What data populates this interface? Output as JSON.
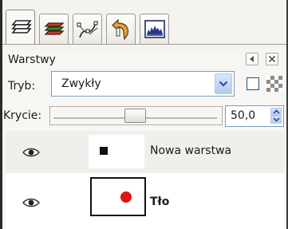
{
  "tabs": [
    {
      "icon": "layers-icon",
      "active": true
    },
    {
      "icon": "channels-icon",
      "active": false
    },
    {
      "icon": "paths-icon",
      "active": false
    },
    {
      "icon": "undo-history-icon",
      "active": false
    },
    {
      "icon": "histogram-icon",
      "active": false
    }
  ],
  "panel": {
    "title": "Warstwy",
    "menu_icon": "panel-menu-icon",
    "close_icon": "close-icon"
  },
  "mode": {
    "label": "Tryb:",
    "value": "Zwykły",
    "keep_alpha_checked": false,
    "alpha_icon": "lock-alpha-icon"
  },
  "opacity": {
    "label": "Krycie:",
    "value": "50,0",
    "level_percent": 50
  },
  "layers": [
    {
      "name": "Nowa warstwa",
      "visible": true,
      "active": false,
      "thumb_mark": "black-square"
    },
    {
      "name": "Tło",
      "visible": true,
      "active": true,
      "thumb_mark": "red-dot"
    }
  ],
  "colors": {
    "mark_black": "#111111",
    "mark_red": "#e01414",
    "accent_blue": "#b3caf2"
  }
}
